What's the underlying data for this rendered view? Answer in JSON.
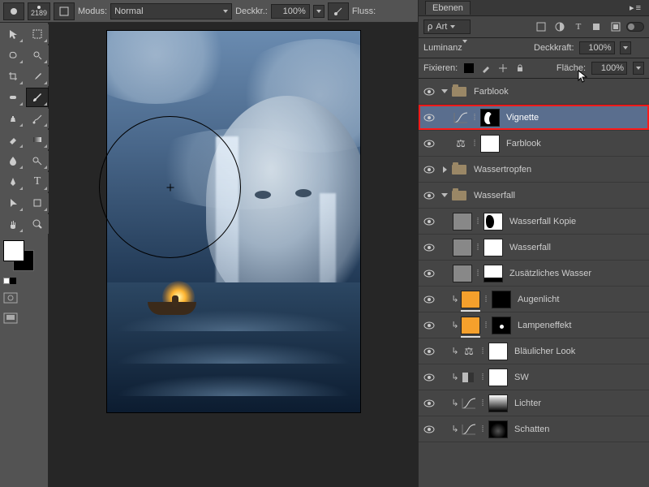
{
  "topbar": {
    "brush_size": "2189",
    "modus_label": "Modus:",
    "modus_value": "Normal",
    "opacity_label": "Deckkr.:",
    "opacity_value": "100%",
    "flow_label": "Fluss:"
  },
  "panel": {
    "title": "Ebenen",
    "filter_label": "Art",
    "blend_mode": "Luminanz",
    "opacity_label": "Deckkraft:",
    "opacity_value": "100%",
    "lock_label": "Fixieren:",
    "fill_label": "Fläche:",
    "fill_value": "100%"
  },
  "layers": [
    {
      "type": "group",
      "name": "Farblook",
      "expanded": true,
      "indent": 0
    },
    {
      "type": "adj",
      "name": "Vignette",
      "icon": "curves",
      "mask": "dark",
      "indent": 1,
      "selected": true,
      "highlight": true
    },
    {
      "type": "adj",
      "name": "Farblook",
      "icon": "balance",
      "mask": "white",
      "indent": 1
    },
    {
      "type": "group",
      "name": "Wassertropfen",
      "expanded": false,
      "indent": 0
    },
    {
      "type": "group",
      "name": "Wasserfall",
      "expanded": true,
      "indent": 0
    },
    {
      "type": "layer",
      "name": "Wasserfall Kopie",
      "thumb": "checker",
      "mask": "splotch",
      "indent": 1
    },
    {
      "type": "layer",
      "name": "Wasserfall",
      "thumb": "checker",
      "mask": "white",
      "indent": 1
    },
    {
      "type": "layer",
      "name": "Zusätzliches Wasser",
      "thumb": "checker",
      "mask": "white-line",
      "indent": 1
    },
    {
      "type": "adj",
      "name": "Augenlicht",
      "icon": "fill-orange",
      "mask": "black",
      "indent": 1,
      "clip": true
    },
    {
      "type": "adj",
      "name": "Lampeneffekt",
      "icon": "fill-orange",
      "mask": "black-dot",
      "indent": 1,
      "clip": true
    },
    {
      "type": "adj",
      "name": "Bläulicher Look",
      "icon": "balance",
      "mask": "white",
      "indent": 1,
      "clip": true
    },
    {
      "type": "adj",
      "name": "SW",
      "icon": "sw",
      "mask": "white",
      "indent": 1,
      "clip": true
    },
    {
      "type": "adj",
      "name": "Lichter",
      "icon": "curves",
      "mask": "grad",
      "indent": 1,
      "clip": true
    },
    {
      "type": "adj",
      "name": "Schatten",
      "icon": "curves",
      "mask": "black-blob",
      "indent": 1,
      "clip": true
    }
  ]
}
